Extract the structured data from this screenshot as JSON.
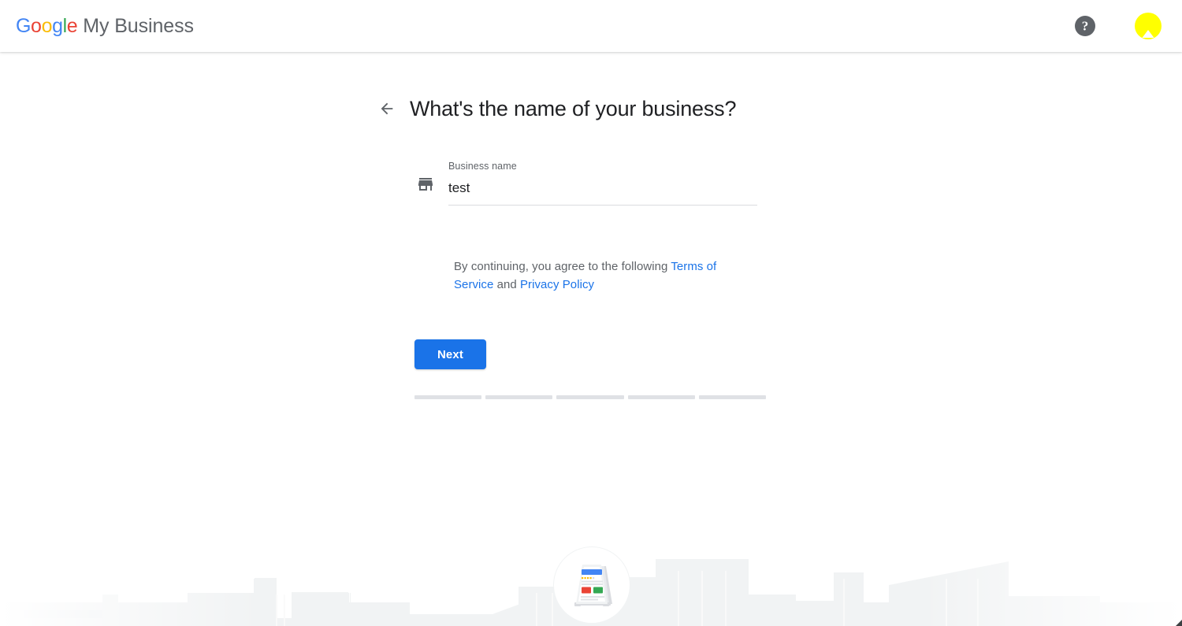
{
  "header": {
    "logo": {
      "google_letters": [
        {
          "char": "G",
          "color": "#4285F4"
        },
        {
          "char": "o",
          "color": "#EA4335"
        },
        {
          "char": "o",
          "color": "#FBBC05"
        },
        {
          "char": "g",
          "color": "#4285F4"
        },
        {
          "char": "l",
          "color": "#34A853"
        },
        {
          "char": "e",
          "color": "#EA4335"
        }
      ],
      "product_name": "My Business"
    },
    "help_icon": "help-question-icon",
    "help_glyph": "?",
    "avatar_icon": "user-avatar-icon",
    "avatar_color": "#FFFF00"
  },
  "main": {
    "back_icon": "back-arrow-icon",
    "title": "What's the name of your business?",
    "field": {
      "icon": "storefront-icon",
      "label": "Business name",
      "value": "test",
      "placeholder": "Business name"
    },
    "legal": {
      "prefix": "By continuing, you agree to the following ",
      "terms_link": "Terms of Service",
      "conjunction": " and ",
      "privacy_link": "Privacy Policy",
      "link_color": "#1a73e8"
    },
    "next_button": {
      "label": "Next",
      "color": "#1a73e8"
    },
    "progress": {
      "total_steps": 5,
      "current_step": 0,
      "inactive_color": "#dfe1e5",
      "active_color": "#1a73e8"
    }
  },
  "illustration": {
    "name": "a-frame-sign-illustration",
    "background": "city-skyline-silhouette",
    "skyline_color": "#f1f3f4",
    "sign_accent_blue": "#4285F4",
    "sign_accent_red": "#EA4335",
    "sign_accent_green": "#34A853",
    "sign_accent_yellow": "#FBBC05"
  }
}
